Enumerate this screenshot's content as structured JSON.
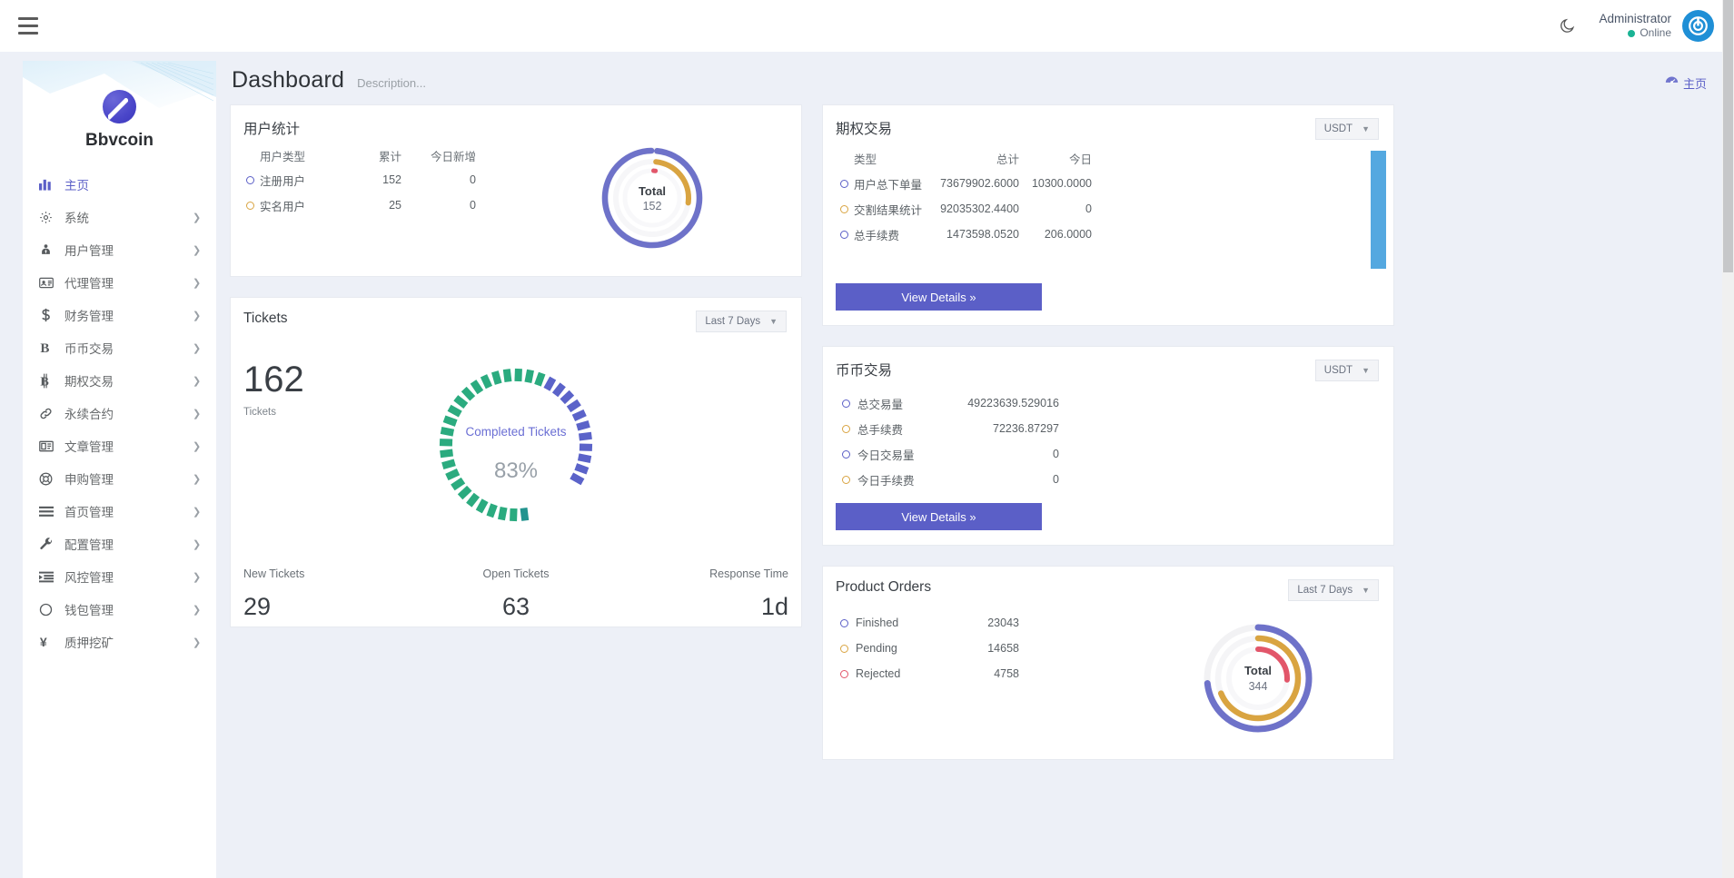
{
  "topbar": {
    "menu_icon": "hamburger-icon",
    "theme_icon": "moon-icon",
    "user_name": "Administrator",
    "user_status": "Online",
    "avatar_icon": "power-logo-icon"
  },
  "sidebar": {
    "brand_name": "Bbvcoin",
    "items": [
      {
        "label": "主页",
        "icon": "bar-chart-icon",
        "active": true,
        "chevron": false
      },
      {
        "label": "系统",
        "icon": "gear-icon",
        "active": false,
        "chevron": true
      },
      {
        "label": "用户管理",
        "icon": "user-tie-icon",
        "active": false,
        "chevron": true
      },
      {
        "label": "代理管理",
        "icon": "id-card-icon",
        "active": false,
        "chevron": true
      },
      {
        "label": "财务管理",
        "icon": "dollar-icon",
        "active": false,
        "chevron": true
      },
      {
        "label": "币币交易",
        "icon": "letter-b-icon",
        "active": false,
        "chevron": true
      },
      {
        "label": "期权交易",
        "icon": "bitcoin-icon",
        "active": false,
        "chevron": true
      },
      {
        "label": "永续合约",
        "icon": "link-icon",
        "active": false,
        "chevron": true
      },
      {
        "label": "文章管理",
        "icon": "article-icon",
        "active": false,
        "chevron": true
      },
      {
        "label": "申购管理",
        "icon": "lifebuoy-icon",
        "active": false,
        "chevron": true
      },
      {
        "label": "首页管理",
        "icon": "list-lines-icon",
        "active": false,
        "chevron": true
      },
      {
        "label": "配置管理",
        "icon": "wrench-icon",
        "active": false,
        "chevron": true
      },
      {
        "label": "风控管理",
        "icon": "indent-icon",
        "active": false,
        "chevron": true
      },
      {
        "label": "钱包管理",
        "icon": "circle-icon",
        "active": false,
        "chevron": true
      },
      {
        "label": "质押挖矿",
        "icon": "yen-icon",
        "active": false,
        "chevron": true
      }
    ]
  },
  "page": {
    "title": "Dashboard",
    "description": "Description...",
    "breadcrumb_label": "主页",
    "breadcrumb_icon": "dashboard-icon"
  },
  "user_stats": {
    "title": "用户统计",
    "headers": [
      "用户类型",
      "累计",
      "今日新增"
    ],
    "rows": [
      {
        "marker": "purple",
        "type": "注册用户",
        "total": "152",
        "today": "0"
      },
      {
        "marker": "gold",
        "type": "实名用户",
        "total": "25",
        "today": "0"
      }
    ],
    "donut": {
      "center_label": "Total",
      "center_value": "152"
    }
  },
  "option_trade": {
    "title": "期权交易",
    "currency": "USDT",
    "headers": [
      "类型",
      "总计",
      "今日"
    ],
    "rows": [
      {
        "marker": "purple",
        "type": "用户总下单量",
        "total": "73679902.6000",
        "today": "10300.0000"
      },
      {
        "marker": "gold",
        "type": "交割结果统计",
        "total": "92035302.4400",
        "today": "0"
      },
      {
        "marker": "purple",
        "type": "总手续费",
        "total": "1473598.0520",
        "today": "206.0000"
      }
    ],
    "button_label": "View Details »"
  },
  "tickets": {
    "title": "Tickets",
    "range": "Last 7 Days",
    "count": "162",
    "count_label": "Tickets",
    "gauge_title": "Completed Tickets",
    "gauge_percent": "83%",
    "footer": [
      {
        "label": "New Tickets",
        "value": "29"
      },
      {
        "label": "Open Tickets",
        "value": "63"
      },
      {
        "label": "Response Time",
        "value": "1d"
      }
    ]
  },
  "coin_trade": {
    "title": "币币交易",
    "currency": "USDT",
    "rows": [
      {
        "marker": "purple",
        "label": "总交易量",
        "value": "49223639.529016"
      },
      {
        "marker": "gold",
        "label": "总手续费",
        "value": "72236.87297"
      },
      {
        "marker": "purple",
        "label": "今日交易量",
        "value": "0"
      },
      {
        "marker": "gold",
        "label": "今日手续费",
        "value": "0"
      }
    ],
    "button_label": "View Details »"
  },
  "product_orders": {
    "title": "Product Orders",
    "range": "Last 7 Days",
    "rows": [
      {
        "marker": "purple",
        "label": "Finished",
        "value": "23043"
      },
      {
        "marker": "gold",
        "label": "Pending",
        "value": "14658"
      },
      {
        "marker": "red",
        "label": "Rejected",
        "value": "4758"
      }
    ],
    "donut": {
      "center_label": "Total",
      "center_value": "344"
    }
  },
  "chart_data": [
    {
      "type": "pie",
      "name": "user-stats-donut",
      "title": "用户统计",
      "labels": [
        "注册用户",
        "实名用户"
      ],
      "values": [
        152,
        25
      ],
      "colors": [
        "#6e72c9",
        "#d9a441"
      ],
      "center_label": "Total",
      "center_value": 152,
      "legend": "left-table"
    },
    {
      "type": "bar",
      "name": "option-trade-bar",
      "title": "期权交易",
      "categories": [
        "USDT"
      ],
      "values": [
        100
      ],
      "colors": [
        "#54a8e0"
      ],
      "ylim": [
        0,
        100
      ],
      "grid": false
    },
    {
      "type": "pie",
      "name": "completed-tickets-gauge",
      "title": "Completed Tickets",
      "labels": [
        "Completed",
        "Remaining"
      ],
      "values": [
        83,
        17
      ],
      "colors": [
        "#2bab7f",
        "#5b63c9"
      ],
      "center_label": "Completed Tickets",
      "center_value": "83%"
    },
    {
      "type": "pie",
      "name": "product-orders-donut",
      "title": "Product Orders",
      "labels": [
        "Finished",
        "Pending",
        "Rejected"
      ],
      "values": [
        23043,
        14658,
        4758
      ],
      "colors": [
        "#6e72c9",
        "#d9a441",
        "#e2566a"
      ],
      "center_label": "Total",
      "center_value": 344
    }
  ]
}
